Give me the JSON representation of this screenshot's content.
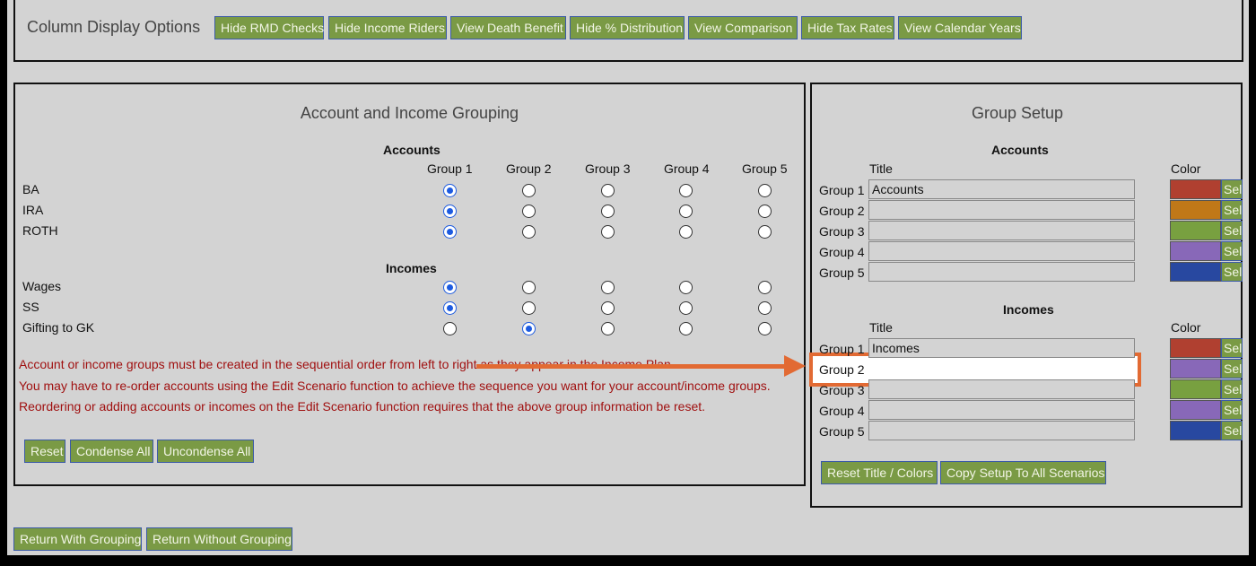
{
  "column_display": {
    "label": "Column Display Options",
    "buttons": [
      "Hide RMD Checks",
      "Hide Income Riders",
      "View Death Benefit",
      "Hide % Distribution",
      "View Comparison",
      "Hide Tax Rates",
      "View Calendar Years"
    ]
  },
  "grouping": {
    "title": "Account and Income Grouping",
    "group_headers": [
      "Group 1",
      "Group 2",
      "Group 3",
      "Group 4",
      "Group 5"
    ],
    "accounts_label": "Accounts",
    "accounts": [
      {
        "name": "BA",
        "selected_group": 1
      },
      {
        "name": "IRA",
        "selected_group": 1
      },
      {
        "name": "ROTH",
        "selected_group": 1
      }
    ],
    "incomes_label": "Incomes",
    "incomes": [
      {
        "name": "Wages",
        "selected_group": 1
      },
      {
        "name": "SS",
        "selected_group": 1
      },
      {
        "name": "Gifting to GK",
        "selected_group": 2
      }
    ],
    "notes": [
      "Account or income groups must be created in the sequential order from left to right as they appear in the Income Plan.",
      "You may have to re-order accounts using the Edit Scenario function to achieve the sequence you want for your account/income groups.",
      "Reordering or adding accounts or incomes on the Edit Scenario function requires that the above group information be reset."
    ],
    "buttons": {
      "reset": "Reset",
      "condense": "Condense All",
      "uncondense": "Uncondense All"
    }
  },
  "group_setup": {
    "title": "Group Setup",
    "title_col": "Title",
    "color_col": "Color",
    "sel_label": "Sel",
    "accounts_label": "Accounts",
    "accounts": [
      {
        "label": "Group 1",
        "title": "Accounts",
        "color": "#b04030"
      },
      {
        "label": "Group 2",
        "title": "",
        "color": "#c07818"
      },
      {
        "label": "Group 3",
        "title": "",
        "color": "#78a040"
      },
      {
        "label": "Group 4",
        "title": "",
        "color": "#8868b8"
      },
      {
        "label": "Group 5",
        "title": "",
        "color": "#2848a0"
      }
    ],
    "incomes_label": "Incomes",
    "incomes": [
      {
        "label": "Group 1",
        "title": "Incomes",
        "color": "#b04030"
      },
      {
        "label": "Group 2",
        "title": "",
        "color": "#8868b8"
      },
      {
        "label": "Group 3",
        "title": "",
        "color": "#78a040"
      },
      {
        "label": "Group 4",
        "title": "",
        "color": "#8868b8"
      },
      {
        "label": "Group 5",
        "title": "",
        "color": "#2848a0"
      }
    ],
    "buttons": {
      "reset_colors": "Reset Title / Colors",
      "copy_setup": "Copy Setup To All Scenarios"
    }
  },
  "footer": {
    "return_with": "Return With Grouping",
    "return_without": "Return Without Grouping"
  },
  "annotation_color": "#e26a33"
}
